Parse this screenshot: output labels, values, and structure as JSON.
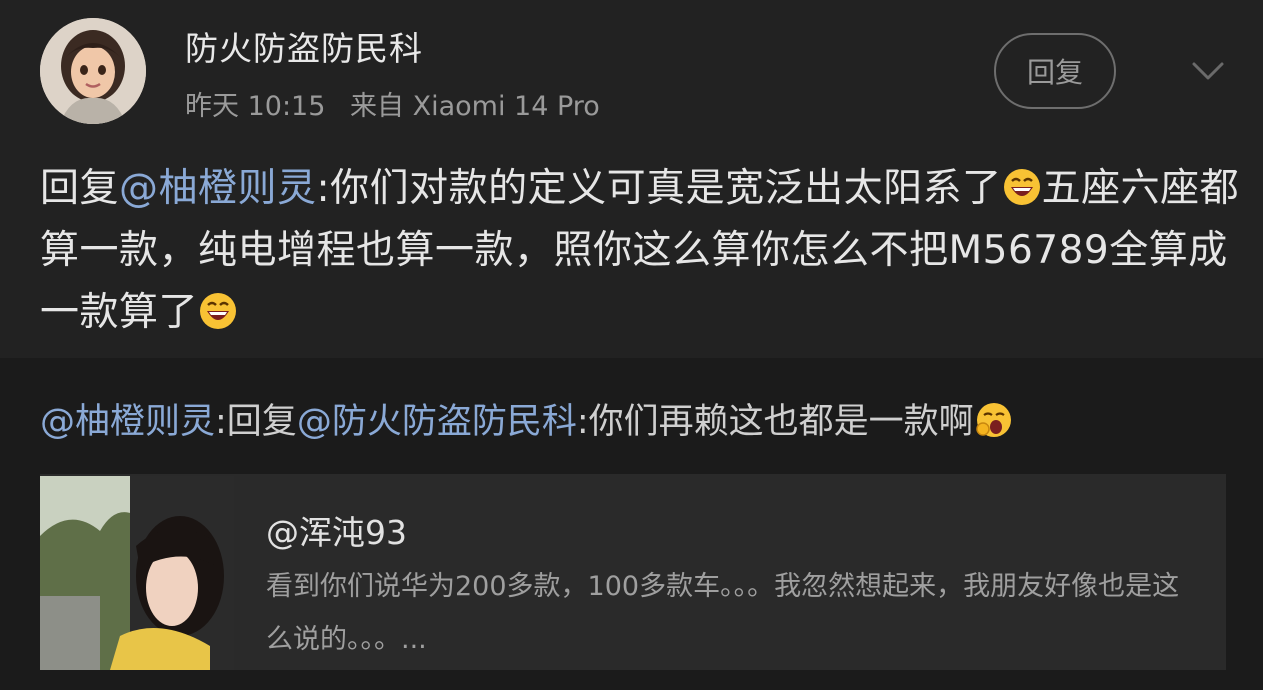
{
  "comment": {
    "username": "防火防盗防民科",
    "time": "昨天 10:15",
    "source": "来自 Xiaomi 14 Pro",
    "reply_button": "回复",
    "text_prefix": "回复",
    "mention": "@柚橙则灵",
    "text_part1": ":你们对款的定义可真是宽泛出太阳系了",
    "text_part2": "五座六座都算一款，纯电增程也算一款，照你这么算你怎么不把M56789全算成一款算了"
  },
  "quote": {
    "mention1": "@柚橙则灵",
    "text_reply": ":回复",
    "mention2": "@防火防盗防民科",
    "text": ":你们再赖这也都是一款啊",
    "card": {
      "username": "@浑沌93",
      "text": "看到你们说华为200多款，100多款车。。。我忽然想起来，我朋友好像也是这么说的。。。..."
    }
  },
  "icons": {
    "more": "chevron-down-icon",
    "laugh": "grinning-emoji",
    "yawn": "yawning-emoji"
  },
  "colors": {
    "background": "#1b1b1b",
    "card": "#222222",
    "mention": "#8aa9d6",
    "muted": "#9a9a9a"
  }
}
